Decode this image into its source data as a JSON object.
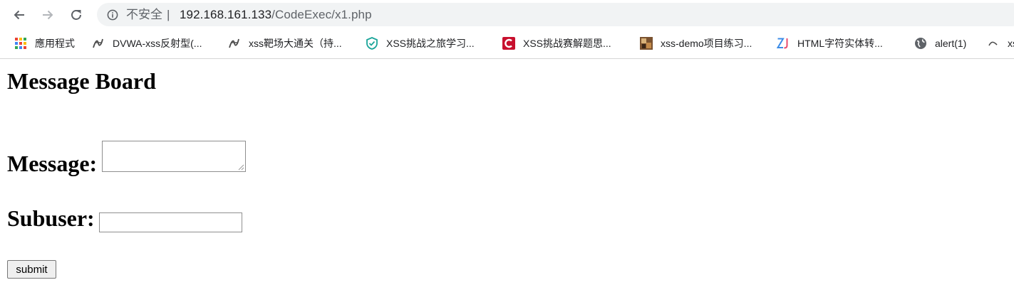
{
  "browser": {
    "security_label": "不安全",
    "url_host": "192.168.161.133",
    "url_path": "/CodeExec/x1.php",
    "nav_icons": [
      "back-arrow-icon",
      "forward-arrow-icon",
      "reload-icon",
      "info-icon"
    ]
  },
  "bookmarks": [
    {
      "label": "應用程式",
      "icon": "apps-grid-icon"
    },
    {
      "label": "DVWA-xss反射型(...",
      "icon": "squiggle-icon"
    },
    {
      "label": "xss靶场大通关（持...",
      "icon": "squiggle-icon"
    },
    {
      "label": "XSS挑战之旅学习...",
      "icon": "shield-icon"
    },
    {
      "label": "XSS挑战赛解题思...",
      "icon": "csdn-c-icon"
    },
    {
      "label": "xss-demo项目练习...",
      "icon": "photo-icon"
    },
    {
      "label": "HTML字符实体转...",
      "icon": "zj-icon"
    },
    {
      "label": "alert(1)",
      "icon": "globe-icon"
    },
    {
      "label": "xs",
      "icon": "squiggle-icon"
    }
  ],
  "page": {
    "title": "Message Board",
    "message_label": "Message:",
    "message_value": "",
    "subuser_label": "Subuser:",
    "subuser_value": "",
    "submit_label": "submit"
  },
  "colors": {
    "omnibox_bg": "#f1f3f4",
    "chrome_icon": "#5f6368",
    "csdn_red": "#c8102e",
    "shield_teal": "#1aa59a",
    "zj_blue": "#3c8ce7"
  }
}
